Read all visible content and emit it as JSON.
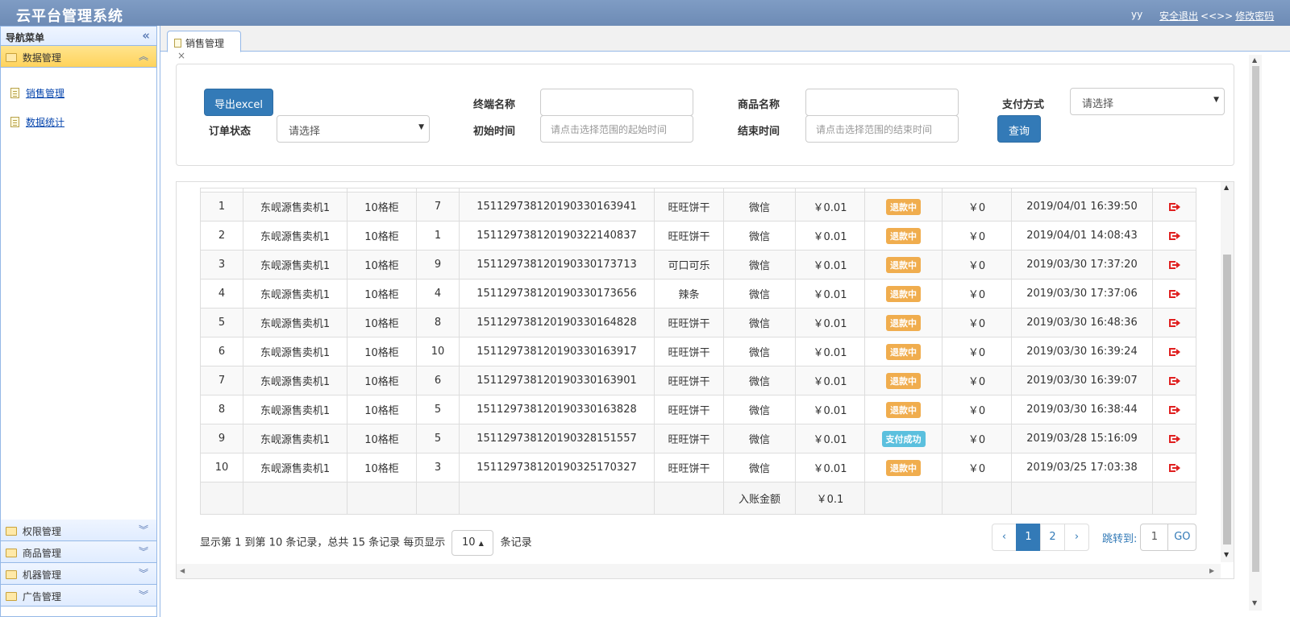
{
  "header": {
    "title": "云平台管理系统",
    "user": "yy",
    "logout": "安全退出",
    "separator": "<<>>",
    "change_password": "修改密码"
  },
  "sidebar": {
    "title": "导航菜单",
    "active_group": "数据管理",
    "items": [
      {
        "label": "销售管理"
      },
      {
        "label": "数据统计"
      }
    ],
    "other_groups": [
      {
        "label": "权限管理"
      },
      {
        "label": "商品管理"
      },
      {
        "label": "机器管理"
      },
      {
        "label": "广告管理"
      }
    ]
  },
  "tab": {
    "label": "销售管理",
    "close": "×"
  },
  "filters": {
    "export_label": "导出excel",
    "terminal_label": "终端名称",
    "product_label": "商品名称",
    "payment_label": "支付方式",
    "payment_value": "请选择",
    "status_label": "订单状态",
    "status_value": "请选择",
    "start_label": "初始时间",
    "start_placeholder": "请点击选择范围的起始时间",
    "end_label": "结束时间",
    "end_placeholder": "请点击选择范围的结束时间",
    "query_label": "查询"
  },
  "table": {
    "rows": [
      [
        "1",
        "东岘源售卖机1",
        "10格柜",
        "7",
        "1511297381201903301639​41",
        "旺旺饼干",
        "微信",
        "￥0.01",
        "退款中",
        "￥0",
        "2019/04/01 16:39:50"
      ],
      [
        "2",
        "东岘源售卖机1",
        "10格柜",
        "1",
        "151129738120190322140837",
        "旺旺饼干",
        "微信",
        "￥0.01",
        "退款中",
        "￥0",
        "2019/04/01 14:08:43"
      ],
      [
        "3",
        "东岘源售卖机1",
        "10格柜",
        "9",
        "151129738120190330173713",
        "可口可乐",
        "微信",
        "￥0.01",
        "退款中",
        "￥0",
        "2019/03/30 17:37:20"
      ],
      [
        "4",
        "东岘源售卖机1",
        "10格柜",
        "4",
        "151129738120190330173656",
        "辣条",
        "微信",
        "￥0.01",
        "退款中",
        "￥0",
        "2019/03/30 17:37:06"
      ],
      [
        "5",
        "东岘源售卖机1",
        "10格柜",
        "8",
        "151129738120190330164828",
        "旺旺饼干",
        "微信",
        "￥0.01",
        "退款中",
        "￥0",
        "2019/03/30 16:48:36"
      ],
      [
        "6",
        "东岘源售卖机1",
        "10格柜",
        "10",
        "151129738120190330163917",
        "旺旺饼干",
        "微信",
        "￥0.01",
        "退款中",
        "￥0",
        "2019/03/30 16:39:24"
      ],
      [
        "7",
        "东岘源售卖机1",
        "10格柜",
        "6",
        "151129738120190330163901",
        "旺旺饼干",
        "微信",
        "￥0.01",
        "退款中",
        "￥0",
        "2019/03/30 16:39:07"
      ],
      [
        "8",
        "东岘源售卖机1",
        "10格柜",
        "5",
        "151129738120190330163828",
        "旺旺饼干",
        "微信",
        "￥0.01",
        "退款中",
        "￥0",
        "2019/03/30 16:38:44"
      ],
      [
        "9",
        "东岘源售卖机1",
        "10格柜",
        "5",
        "151129738120190328151557",
        "旺旺饼干",
        "微信",
        "￥0.01",
        "支付成功",
        "￥0",
        "2019/03/28 15:16:09"
      ],
      [
        "10",
        "东岘源售卖机1",
        "10格柜",
        "3",
        "151129738120190325170327",
        "旺旺饼干",
        "微信",
        "￥0.01",
        "退款中",
        "￥0",
        "2019/03/25 17:03:38"
      ]
    ],
    "footer_label": "入账金额",
    "footer_value": "￥0.1"
  },
  "pagination": {
    "info_prefix": "显示第 1 到第 10 条记录，总共 15 条记录 每页显示",
    "page_size": "10",
    "info_suffix": "条记录",
    "prev": "‹",
    "pages": [
      "1",
      "2"
    ],
    "current": "1",
    "next": "›",
    "jump_label": "跳转到:",
    "jump_value": "1",
    "go": "GO"
  },
  "colors": {
    "header": "#7f9cc4",
    "active_group": "#ffd35c",
    "primary": "#337ab7",
    "refund_badge": "#f0ad4e",
    "success_badge": "#5bc0de",
    "amount_red": "#e02020"
  }
}
